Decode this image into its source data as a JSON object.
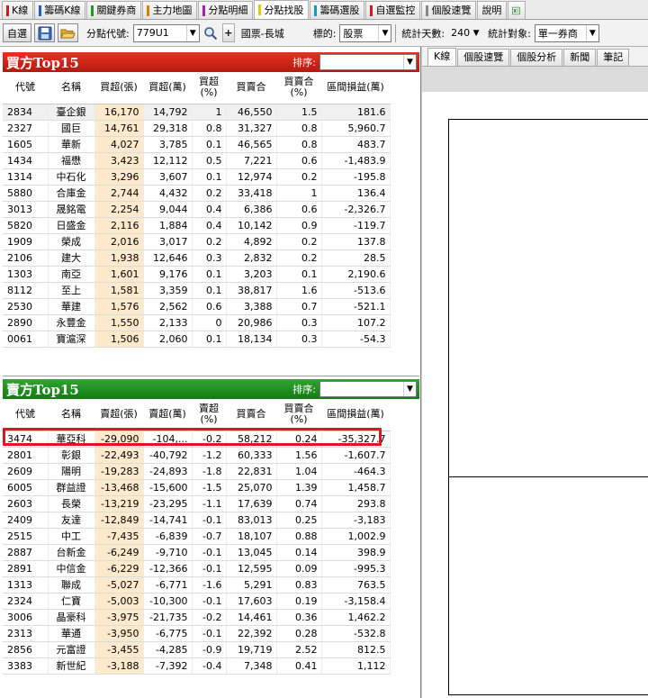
{
  "top_tabs": [
    {
      "label": "K線",
      "color": "#d21a1a",
      "active": false
    },
    {
      "label": "籌碼K線",
      "color": "#1a5fd2",
      "active": false
    },
    {
      "label": "關鍵券商",
      "color": "#1f9a1f",
      "active": false
    },
    {
      "label": "主力地圖",
      "color": "#e07a00",
      "active": false
    },
    {
      "label": "分點明細",
      "color": "#b01ab0",
      "active": false
    },
    {
      "label": "分點找股",
      "color": "#e8c800",
      "active": true
    },
    {
      "label": "籌碼選股",
      "color": "#1a9ab0",
      "active": false
    },
    {
      "label": "自選監控",
      "color": "#d21a1a",
      "active": false
    },
    {
      "label": "個股速覽",
      "color": "#888888",
      "active": false
    },
    {
      "label": "說明",
      "color": "",
      "active": false
    }
  ],
  "toolbar": {
    "self_select_label": "自選",
    "branch_code_label": "分點代號:",
    "branch_code_value": "779U1",
    "branch_name": "國票-長城",
    "target_label": "標的:",
    "target_value": "股票",
    "stat_days_label": "統計天數:",
    "stat_days_value": "240",
    "stat_target_label": "統計對象:",
    "stat_target_value": "單一券商"
  },
  "right_tabs": [
    "K線",
    "個股速覽",
    "個股分析",
    "新聞",
    "筆記"
  ],
  "buy_panel": {
    "title": "買方Top15",
    "sort_label": "排序:",
    "sort_value": "買超(張)",
    "columns": [
      "代號",
      "名稱",
      "買超(張)",
      "買超(萬)",
      "買超\n(%)",
      "買賣合",
      "買賣合\n(%)",
      "區間損益(萬)"
    ],
    "rows": [
      [
        "2834",
        "臺企銀",
        "16,170",
        "14,792",
        "1",
        "46,550",
        "1.5",
        "181.6"
      ],
      [
        "2327",
        "國巨",
        "14,761",
        "29,318",
        "0.8",
        "31,327",
        "0.8",
        "5,960.7"
      ],
      [
        "1605",
        "華新",
        "4,027",
        "3,785",
        "0.1",
        "46,565",
        "0.8",
        "483.7"
      ],
      [
        "1434",
        "福懋",
        "3,423",
        "12,112",
        "0.5",
        "7,221",
        "0.6",
        "-1,483.9"
      ],
      [
        "1314",
        "中石化",
        "3,296",
        "3,607",
        "0.1",
        "12,974",
        "0.2",
        "-195.8"
      ],
      [
        "5880",
        "合庫金",
        "2,744",
        "4,432",
        "0.2",
        "33,418",
        "1",
        "136.4"
      ],
      [
        "3013",
        "晟銘電",
        "2,254",
        "9,044",
        "0.4",
        "6,386",
        "0.6",
        "-2,326.7"
      ],
      [
        "5820",
        "日盛金",
        "2,116",
        "1,884",
        "0.4",
        "10,142",
        "0.9",
        "-119.7"
      ],
      [
        "1909",
        "榮成",
        "2,016",
        "3,017",
        "0.2",
        "4,892",
        "0.2",
        "137.8"
      ],
      [
        "2106",
        "建大",
        "1,938",
        "12,646",
        "0.3",
        "2,832",
        "0.2",
        "28.5"
      ],
      [
        "1303",
        "南亞",
        "1,601",
        "9,176",
        "0.1",
        "3,203",
        "0.1",
        "2,190.6"
      ],
      [
        "8112",
        "至上",
        "1,581",
        "3,359",
        "0.1",
        "38,817",
        "1.6",
        "-513.6"
      ],
      [
        "2530",
        "華建",
        "1,576",
        "2,562",
        "0.6",
        "3,388",
        "0.7",
        "-521.1"
      ],
      [
        "2890",
        "永豐金",
        "1,550",
        "2,133",
        "0",
        "20,986",
        "0.3",
        "107.2"
      ],
      [
        "0061",
        "寶滬深",
        "1,506",
        "2,060",
        "0.1",
        "18,134",
        "0.3",
        "-54.3"
      ]
    ]
  },
  "sell_panel": {
    "title": "賣方Top15",
    "sort_label": "排序:",
    "sort_value": "賣超(張)",
    "columns": [
      "代號",
      "名稱",
      "賣超(張)",
      "賣超(萬)",
      "賣超\n(%)",
      "買賣合",
      "買賣合\n(%)",
      "區間損益(萬)"
    ],
    "rows": [
      [
        "3474",
        "華亞科",
        "-29,090",
        "-104,...",
        "-0.2",
        "58,212",
        "0.24",
        "-35,327.7"
      ],
      [
        "2801",
        "彰銀",
        "-22,493",
        "-40,792",
        "-1.2",
        "60,333",
        "1.56",
        "-1,607.7"
      ],
      [
        "2609",
        "陽明",
        "-19,283",
        "-24,893",
        "-1.8",
        "22,831",
        "1.04",
        "-464.3"
      ],
      [
        "6005",
        "群益證",
        "-13,468",
        "-15,600",
        "-1.5",
        "25,070",
        "1.39",
        "1,458.7"
      ],
      [
        "2603",
        "長榮",
        "-13,219",
        "-23,295",
        "-1.1",
        "17,639",
        "0.74",
        "293.8"
      ],
      [
        "2409",
        "友達",
        "-12,849",
        "-14,741",
        "-0.1",
        "83,013",
        "0.25",
        "-3,183"
      ],
      [
        "2515",
        "中工",
        "-7,435",
        "-6,839",
        "-0.7",
        "18,107",
        "0.88",
        "1,002.9"
      ],
      [
        "2887",
        "台新金",
        "-6,249",
        "-9,710",
        "-0.1",
        "13,045",
        "0.14",
        "398.9"
      ],
      [
        "2891",
        "中信金",
        "-6,229",
        "-12,366",
        "-0.1",
        "12,595",
        "0.09",
        "-995.3"
      ],
      [
        "1313",
        "聯成",
        "-5,027",
        "-6,771",
        "-1.6",
        "5,291",
        "0.83",
        "763.5"
      ],
      [
        "2324",
        "仁寶",
        "-5,003",
        "-10,300",
        "-0.1",
        "17,603",
        "0.19",
        "-3,158.4"
      ],
      [
        "3006",
        "晶豪科",
        "-3,975",
        "-21,735",
        "-0.2",
        "14,461",
        "0.36",
        "1,462.2"
      ],
      [
        "2313",
        "華通",
        "-3,950",
        "-6,775",
        "-0.1",
        "22,392",
        "0.28",
        "-532.8"
      ],
      [
        "2856",
        "元富證",
        "-3,455",
        "-4,285",
        "-0.9",
        "19,719",
        "2.52",
        "812.5"
      ],
      [
        "3383",
        "新世紀",
        "-3,188",
        "-7,392",
        "-0.4",
        "7,348",
        "0.41",
        "1,112"
      ]
    ]
  },
  "icons": {
    "save": "save-icon",
    "open": "folder-open-icon",
    "search": "magnifier-icon",
    "add": "plus-icon",
    "export": "excel-export-icon"
  },
  "colors": {
    "buy_header": "#d42414",
    "sell_header": "#1f8f1f",
    "highlight": "#fde9cc",
    "selected_outline": "#e81022"
  }
}
